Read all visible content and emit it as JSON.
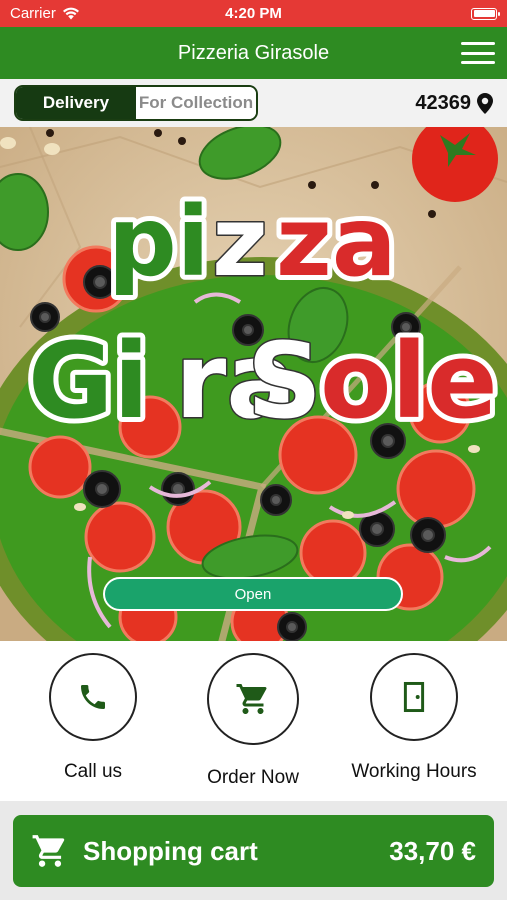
{
  "status_bar": {
    "carrier": "Carrier",
    "time": "4:20 PM"
  },
  "nav": {
    "title": "Pizzeria Girasole"
  },
  "mode": {
    "delivery": "Delivery",
    "collection": "For Collection",
    "active": "Delivery"
  },
  "location": {
    "zip": "42369"
  },
  "hero": {
    "logo_line1": [
      "pi",
      "z",
      "za"
    ],
    "logo_line2": [
      "Gi",
      "ra",
      "S",
      "ole"
    ],
    "open_label": "Open"
  },
  "actions": [
    {
      "label": "Call us",
      "icon": "phone-icon"
    },
    {
      "label": "Order Now",
      "icon": "cart-icon"
    },
    {
      "label": "Working Hours",
      "icon": "door-icon"
    }
  ],
  "cart": {
    "label": "Shopping cart",
    "total": "33,70 €"
  },
  "colors": {
    "status_red": "#e53935",
    "brand_green": "#2e8b22",
    "open_green": "#1aa36b",
    "logo_red": "#d92b2b"
  }
}
